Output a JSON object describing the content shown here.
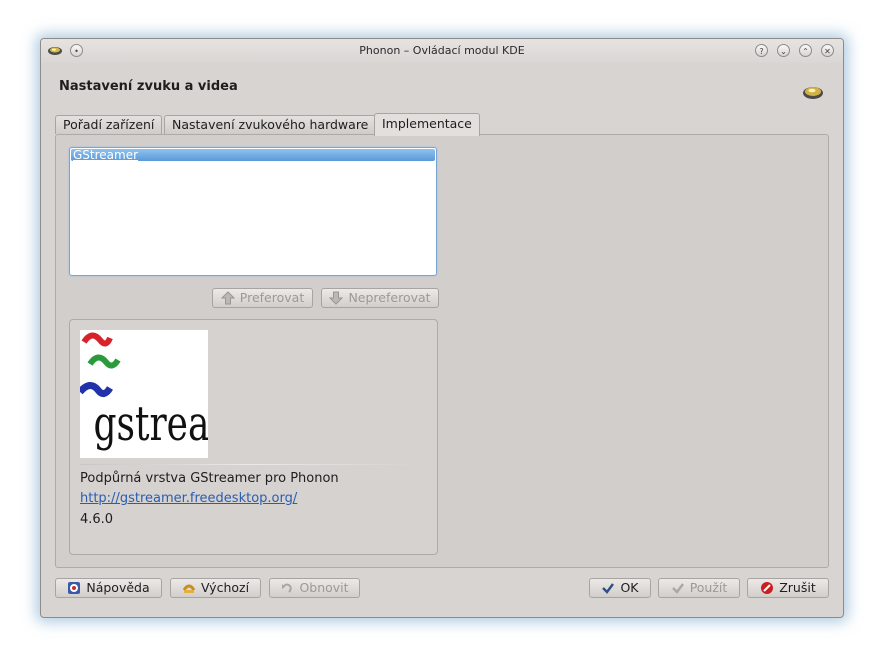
{
  "window": {
    "title": "Phonon – Ovládací modul KDE",
    "titlebar_buttons": [
      "help-icon",
      "minimize-icon",
      "maximize-icon",
      "close-icon"
    ]
  },
  "header": {
    "title": "Nastavení zvuku a videa"
  },
  "tabs": [
    {
      "label": "Pořadí zařízení",
      "active": false
    },
    {
      "label": "Nastavení zvukového hardware",
      "active": false
    },
    {
      "label": "Implementace",
      "active": true
    }
  ],
  "backends": {
    "items": [
      {
        "label": "GStreamer",
        "selected": true
      }
    ]
  },
  "order_buttons": {
    "prefer": "Preferovat",
    "defer": "Nepreferovat"
  },
  "backend_info": {
    "logo_text": "gstreamer",
    "description": "Podpůrná vrstva GStreamer pro Phonon",
    "url": "http://gstreamer.freedesktop.org/",
    "version": "4.6.0"
  },
  "footer": {
    "help": "Nápověda",
    "defaults": "Výchozí",
    "reset": "Obnovit",
    "ok": "OK",
    "apply": "Použít",
    "cancel": "Zrušit"
  },
  "colors": {
    "selection": "#5a9ad9",
    "link": "#2a5db0",
    "window_bg": "#d8d4d2",
    "glow": "#6ea0c8"
  }
}
